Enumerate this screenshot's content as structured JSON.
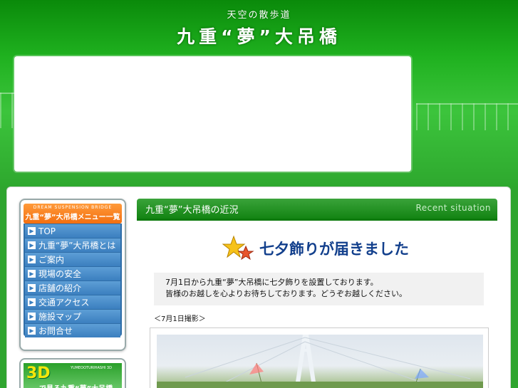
{
  "header": {
    "tagline": "天空の散歩道",
    "site_title": "九重“夢”大吊橋"
  },
  "sidebar": {
    "menu_header_sub": "DREAM SUSPENSION BRIDGE",
    "menu_header_title": "九重“夢”大吊橋メニュー一覧",
    "items": [
      {
        "label": "TOP"
      },
      {
        "label": "九重“夢”大吊橋とは"
      },
      {
        "label": "ご案内"
      },
      {
        "label": "現場の安全"
      },
      {
        "label": "店舗の紹介"
      },
      {
        "label": "交通アクセス"
      },
      {
        "label": "施設マップ"
      },
      {
        "label": "お問合せ"
      }
    ],
    "banner": {
      "big": "3D",
      "small": "YUMEOOTURIHASHI 3D",
      "caption": "で見る九重“夢”大吊橋"
    }
  },
  "content": {
    "section_title": "九重“夢”大吊橋の近況",
    "section_title_en": "Recent situation",
    "headline": "七夕飾りが届きました",
    "notice_line1": "7月1日から九重“夢”大吊橋に七夕飾りを設置しております。",
    "notice_line2": "皆様のお越しを心よりお待ちしております。どうぞお越しください。",
    "date_label": "＜7月1日撮影＞"
  },
  "colors": {
    "header_green": "#1fb11f",
    "menu_header_orange": "#f36f10",
    "menu_blue": "#3b7fbf",
    "headline_blue": "#123f8c"
  }
}
